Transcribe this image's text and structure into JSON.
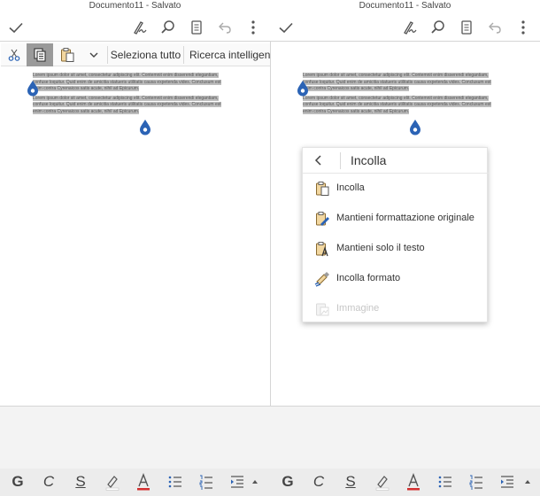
{
  "left": {
    "title": "Documento11 - Salvato",
    "context_bar": {
      "select_all": "Seleziona tutto",
      "smart_lookup": "Ricerca intelligente"
    }
  },
  "right": {
    "title": "Documento11 - Salvato",
    "paste_menu": {
      "title": "Incolla",
      "items": [
        {
          "label": "Incolla",
          "icon": "paste-icon",
          "enabled": true
        },
        {
          "label": "Mantieni formattazione originale",
          "icon": "keep-source-formatting-icon",
          "enabled": true
        },
        {
          "label": "Mantieni solo il testo",
          "icon": "keep-text-only-icon",
          "enabled": true
        },
        {
          "label": "Incolla formato",
          "icon": "paste-format-icon",
          "enabled": true
        },
        {
          "label": "Immagine",
          "icon": "paste-picture-icon",
          "enabled": false
        }
      ]
    }
  },
  "document": {
    "paragraph1_line1": "Lorem ipsum dolor sit amet, consectetur adipiscing elit. Contemnit enim disserendi elegantiam,",
    "paragraph1_line2": "confuse loquitur. Quid enim de amicitia statueris utilitatis causa expetenda vides. Conclusum est",
    "paragraph1_line3": "enim contra Cyrenaicos satis acute, nihil ad Epicurum.",
    "paragraph2_line1": "Lorem ipsum dolor sit amet, consectetur adipiscing elit. Contemnit enim disserendi elegantiam,",
    "paragraph2_line2": "confuse loquitur. Quid enim de amicitia statueris utilitatis causa expetenda vides. Conclusum est",
    "paragraph2_line3": "enim contra Cyrenaicos satis acute, nihil ad Epicurum."
  },
  "format_toolbar": {
    "bold": "G",
    "italic": "C",
    "underline": "S"
  },
  "colors": {
    "accent_blue": "#2b63b5",
    "font_color_red": "#d32f2f",
    "highlight_gray": "#bdbdbd"
  }
}
